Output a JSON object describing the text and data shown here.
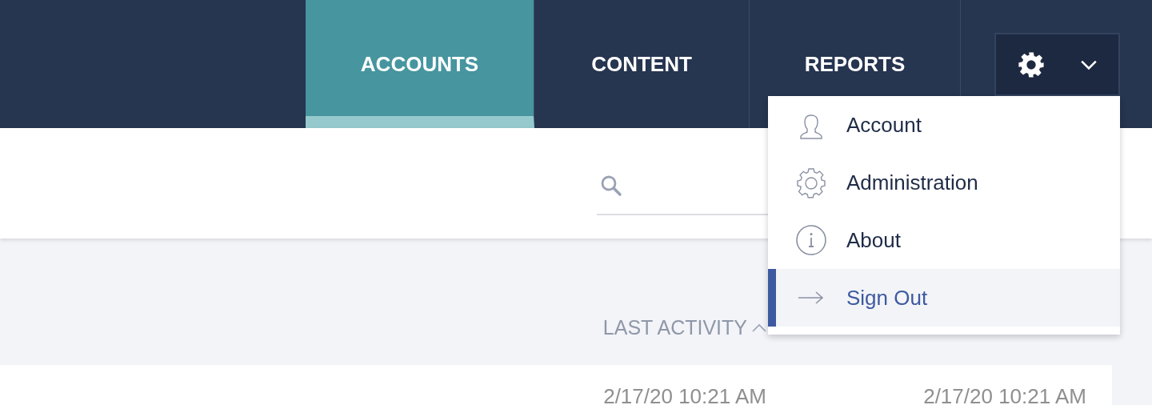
{
  "nav_tabs": [
    {
      "label": "ACCOUNTS",
      "selected": true
    },
    {
      "label": "CONTENT",
      "selected": false
    },
    {
      "label": "REPORTS",
      "selected": false
    }
  ],
  "settings_menu": {
    "expanded": true,
    "items": [
      {
        "kind": "person",
        "label": "Account",
        "selected": false
      },
      {
        "kind": "gear",
        "label": "Administration",
        "selected": false
      },
      {
        "kind": "info",
        "label": "About",
        "selected": false
      },
      {
        "kind": "arrow",
        "label": "Sign Out",
        "selected": true
      }
    ]
  },
  "table": {
    "columns": [
      {
        "label": "LAST ACTIVITY",
        "sorted_ascending": true
      }
    ],
    "rows": [
      {
        "cells": [
          "2/17/20 10:21 AM",
          "2/17/20 10:21 AM"
        ]
      }
    ]
  }
}
